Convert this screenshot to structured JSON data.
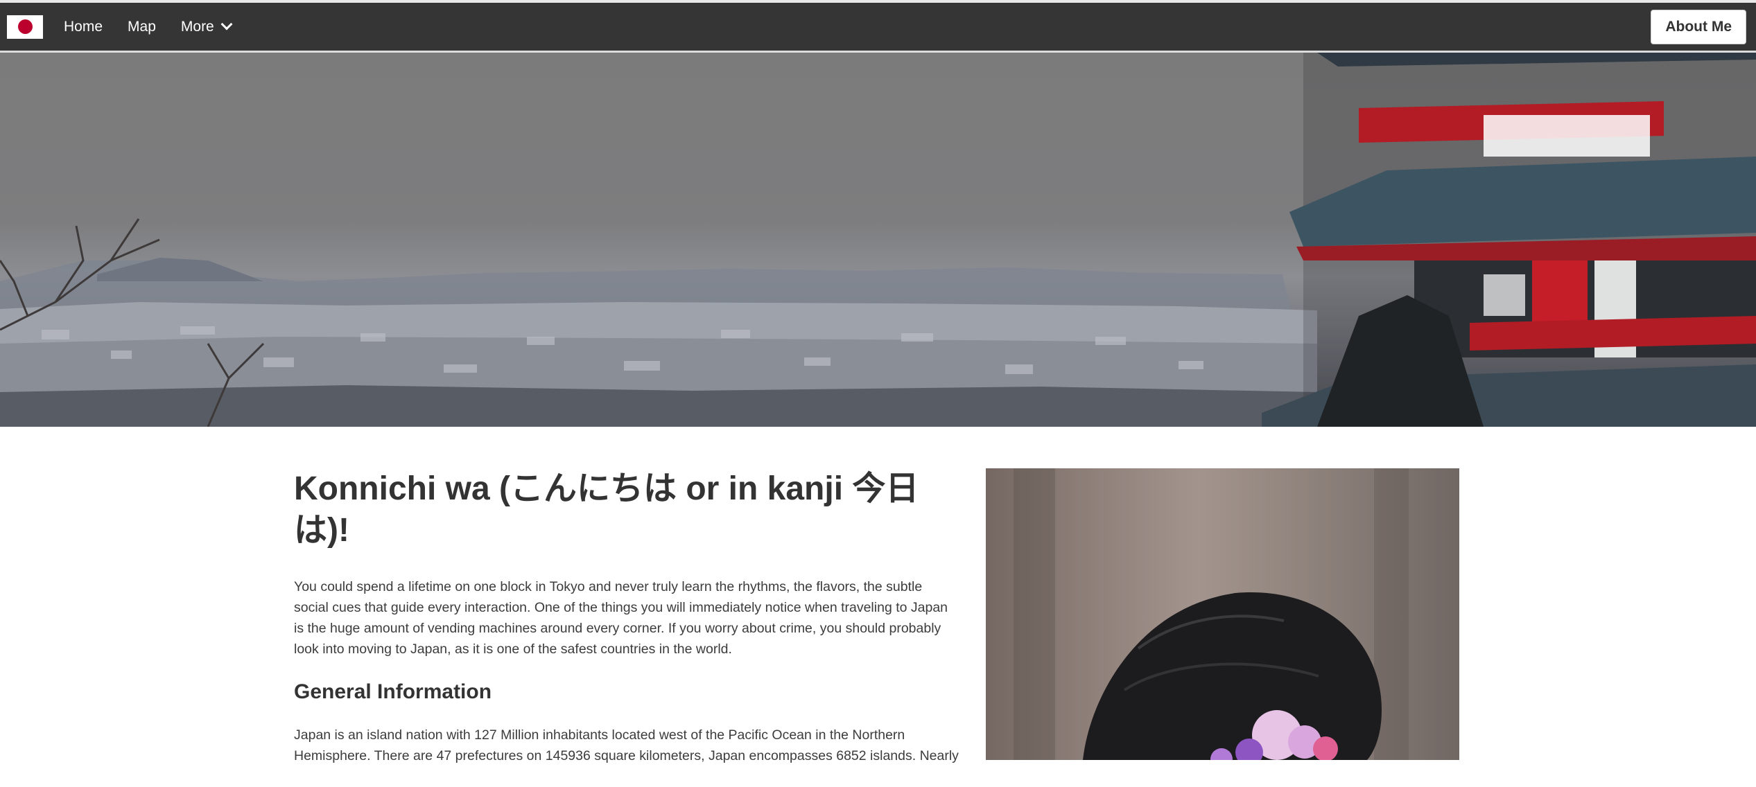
{
  "navbar": {
    "logo_icon": "japan-flag-icon",
    "links": [
      {
        "label": "Home"
      },
      {
        "label": "Map"
      },
      {
        "label": "More",
        "icon": "chevron-down-icon"
      }
    ],
    "about_button": "About Me"
  },
  "colors": {
    "navbar_bg": "#353535",
    "flag_red": "#bc002d",
    "text": "#333333"
  },
  "main": {
    "title": "Konnichi wa (こんにちは or in kanji 今日は)!",
    "intro": "You could spend a lifetime on one block in Tokyo and never truly learn the rhythms, the flavors, the subtle social cues that guide every interaction. One of the things you will immediately notice when traveling to Japan is the huge amount of vending machines around every corner. If you worry about crime, you should probably look into moving to Japan, as it is one of the safest countries in the world.",
    "general_heading": "General Information",
    "general_text": "Japan is an island nation with 127 Million inhabitants located west of the Pacific Ocean in the Northern Hemisphere. There are 47 prefectures on 145936 square kilometers, Japan encompasses 6852 islands. Nearly"
  }
}
